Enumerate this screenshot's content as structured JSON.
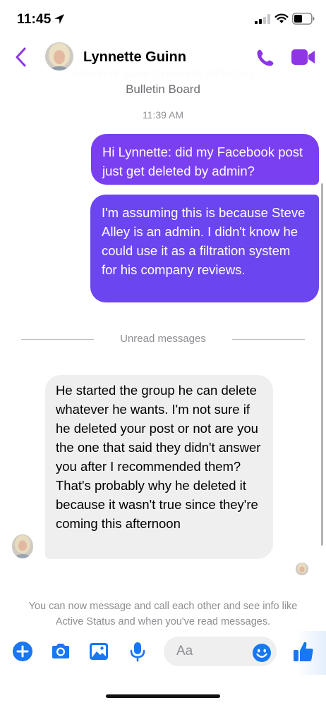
{
  "status_bar": {
    "time": "11:45"
  },
  "header": {
    "contact_name": "Lynnette Guinn",
    "accent_color": "#8e35e6"
  },
  "chat": {
    "group_info_line1": "Admin of Save Creekers Infamous",
    "group_info_line2": "Bulletin Board",
    "timestamp": "11:39 AM",
    "messages": [
      {
        "direction": "outgoing",
        "text": "Hi Lynnette: did my Facebook post just get deleted by admin?"
      },
      {
        "direction": "outgoing",
        "text": "I'm assuming this is because Steve Alley is an admin. I didn't know he could use it as a filtration system for his company reviews."
      },
      {
        "direction": "incoming",
        "text": "He started the group he can delete whatever he wants. I'm not sure if he deleted your post or not are you the one that said they didn't answer you after I recommended them? That's probably why he deleted it because it wasn't true since they're coming this afternoon"
      }
    ],
    "unread_divider": "Unread messages",
    "notice": "You can now message and call each other and see info like Active Status and when you've read messages."
  },
  "composer": {
    "placeholder": "Aa",
    "value": ""
  },
  "icons": {
    "back": "chevron-left-icon",
    "call": "phone-icon",
    "video": "video-camera-icon",
    "plus": "plus-circle-icon",
    "camera": "camera-icon",
    "gallery": "image-icon",
    "mic": "microphone-icon",
    "emoji": "smiley-icon",
    "like": "thumbs-up-icon"
  },
  "colors": {
    "outgoing_bubble_top": "#7b3ff2",
    "outgoing_bubble_bottom": "#6b46f0",
    "incoming_bubble": "#efefef",
    "composer_icons": "#1877f2"
  }
}
